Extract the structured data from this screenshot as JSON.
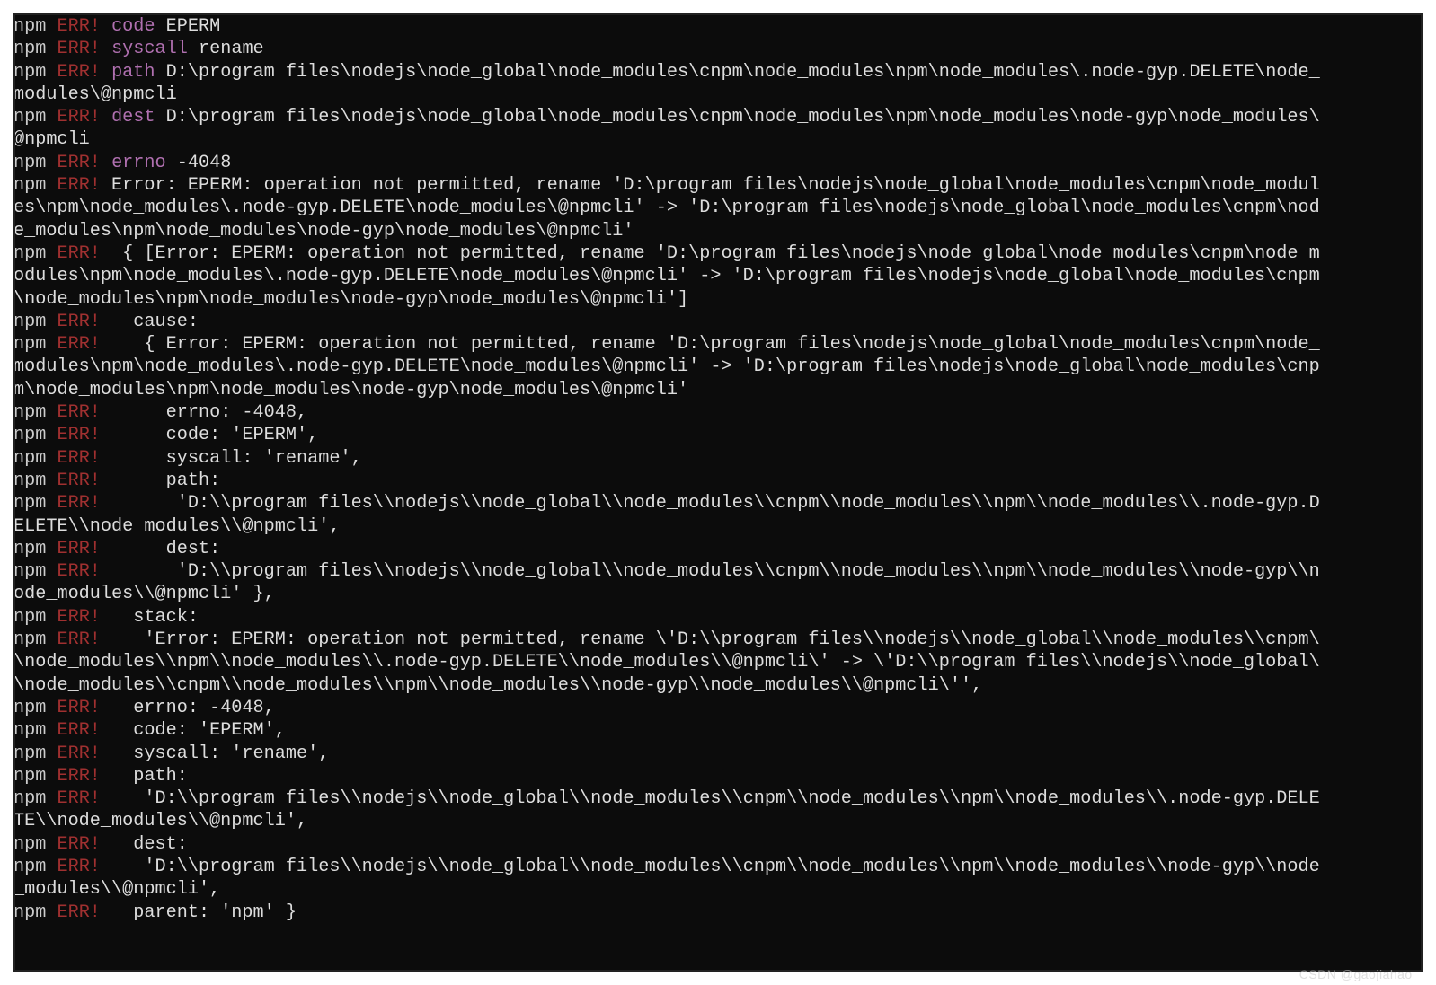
{
  "watermark": "CSDN @gaojiahao_",
  "lines": [
    [
      {
        "c": "npm",
        "t": "npm"
      },
      {
        "c": "txt",
        "t": " "
      },
      {
        "c": "err",
        "t": "ERR!"
      },
      {
        "c": "txt",
        "t": " "
      },
      {
        "c": "key",
        "t": "code"
      },
      {
        "c": "txt",
        "t": " EPERM"
      }
    ],
    [
      {
        "c": "npm",
        "t": "npm"
      },
      {
        "c": "txt",
        "t": " "
      },
      {
        "c": "err",
        "t": "ERR!"
      },
      {
        "c": "txt",
        "t": " "
      },
      {
        "c": "key",
        "t": "syscall"
      },
      {
        "c": "txt",
        "t": " rename"
      }
    ],
    [
      {
        "c": "npm",
        "t": "npm"
      },
      {
        "c": "txt",
        "t": " "
      },
      {
        "c": "err",
        "t": "ERR!"
      },
      {
        "c": "txt",
        "t": " "
      },
      {
        "c": "key",
        "t": "path"
      },
      {
        "c": "txt",
        "t": " D:\\program files\\nodejs\\node_global\\node_modules\\cnpm\\node_modules\\npm\\node_modules\\.node-gyp.DELETE\\node_"
      }
    ],
    [
      {
        "c": "txt",
        "t": "modules\\@npmcli"
      }
    ],
    [
      {
        "c": "npm",
        "t": "npm"
      },
      {
        "c": "txt",
        "t": " "
      },
      {
        "c": "err",
        "t": "ERR!"
      },
      {
        "c": "txt",
        "t": " "
      },
      {
        "c": "key",
        "t": "dest"
      },
      {
        "c": "txt",
        "t": " D:\\program files\\nodejs\\node_global\\node_modules\\cnpm\\node_modules\\npm\\node_modules\\node-gyp\\node_modules\\"
      }
    ],
    [
      {
        "c": "txt",
        "t": "@npmcli"
      }
    ],
    [
      {
        "c": "npm",
        "t": "npm"
      },
      {
        "c": "txt",
        "t": " "
      },
      {
        "c": "err",
        "t": "ERR!"
      },
      {
        "c": "txt",
        "t": " "
      },
      {
        "c": "key",
        "t": "errno"
      },
      {
        "c": "txt",
        "t": " -4048"
      }
    ],
    [
      {
        "c": "npm",
        "t": "npm"
      },
      {
        "c": "txt",
        "t": " "
      },
      {
        "c": "err",
        "t": "ERR!"
      },
      {
        "c": "txt",
        "t": " Error: EPERM: operation not permitted, rename 'D:\\program files\\nodejs\\node_global\\node_modules\\cnpm\\node_modul"
      }
    ],
    [
      {
        "c": "txt",
        "t": "es\\npm\\node_modules\\.node-gyp.DELETE\\node_modules\\@npmcli' -> 'D:\\program files\\nodejs\\node_global\\node_modules\\cnpm\\nod"
      }
    ],
    [
      {
        "c": "txt",
        "t": "e_modules\\npm\\node_modules\\node-gyp\\node_modules\\@npmcli'"
      }
    ],
    [
      {
        "c": "npm",
        "t": "npm"
      },
      {
        "c": "txt",
        "t": " "
      },
      {
        "c": "err",
        "t": "ERR!"
      },
      {
        "c": "txt",
        "t": "  { [Error: EPERM: operation not permitted, rename 'D:\\program files\\nodejs\\node_global\\node_modules\\cnpm\\node_m"
      }
    ],
    [
      {
        "c": "txt",
        "t": "odules\\npm\\node_modules\\.node-gyp.DELETE\\node_modules\\@npmcli' -> 'D:\\program files\\nodejs\\node_global\\node_modules\\cnpm"
      }
    ],
    [
      {
        "c": "txt",
        "t": "\\node_modules\\npm\\node_modules\\node-gyp\\node_modules\\@npmcli']"
      }
    ],
    [
      {
        "c": "npm",
        "t": "npm"
      },
      {
        "c": "txt",
        "t": " "
      },
      {
        "c": "err",
        "t": "ERR!"
      },
      {
        "c": "txt",
        "t": "   cause:"
      }
    ],
    [
      {
        "c": "npm",
        "t": "npm"
      },
      {
        "c": "txt",
        "t": " "
      },
      {
        "c": "err",
        "t": "ERR!"
      },
      {
        "c": "txt",
        "t": "    { Error: EPERM: operation not permitted, rename 'D:\\program files\\nodejs\\node_global\\node_modules\\cnpm\\node_"
      }
    ],
    [
      {
        "c": "txt",
        "t": "modules\\npm\\node_modules\\.node-gyp.DELETE\\node_modules\\@npmcli' -> 'D:\\program files\\nodejs\\node_global\\node_modules\\cnp"
      }
    ],
    [
      {
        "c": "txt",
        "t": "m\\node_modules\\npm\\node_modules\\node-gyp\\node_modules\\@npmcli'"
      }
    ],
    [
      {
        "c": "npm",
        "t": "npm"
      },
      {
        "c": "txt",
        "t": " "
      },
      {
        "c": "err",
        "t": "ERR!"
      },
      {
        "c": "txt",
        "t": "      errno: -4048,"
      }
    ],
    [
      {
        "c": "npm",
        "t": "npm"
      },
      {
        "c": "txt",
        "t": " "
      },
      {
        "c": "err",
        "t": "ERR!"
      },
      {
        "c": "txt",
        "t": "      code: 'EPERM',"
      }
    ],
    [
      {
        "c": "npm",
        "t": "npm"
      },
      {
        "c": "txt",
        "t": " "
      },
      {
        "c": "err",
        "t": "ERR!"
      },
      {
        "c": "txt",
        "t": "      syscall: 'rename',"
      }
    ],
    [
      {
        "c": "npm",
        "t": "npm"
      },
      {
        "c": "txt",
        "t": " "
      },
      {
        "c": "err",
        "t": "ERR!"
      },
      {
        "c": "txt",
        "t": "      path:"
      }
    ],
    [
      {
        "c": "npm",
        "t": "npm"
      },
      {
        "c": "txt",
        "t": " "
      },
      {
        "c": "err",
        "t": "ERR!"
      },
      {
        "c": "txt",
        "t": "       'D:\\\\program files\\\\nodejs\\\\node_global\\\\node_modules\\\\cnpm\\\\node_modules\\\\npm\\\\node_modules\\\\.node-gyp.D"
      }
    ],
    [
      {
        "c": "txt",
        "t": "ELETE\\\\node_modules\\\\@npmcli',"
      }
    ],
    [
      {
        "c": "npm",
        "t": "npm"
      },
      {
        "c": "txt",
        "t": " "
      },
      {
        "c": "err",
        "t": "ERR!"
      },
      {
        "c": "txt",
        "t": "      dest:"
      }
    ],
    [
      {
        "c": "npm",
        "t": "npm"
      },
      {
        "c": "txt",
        "t": " "
      },
      {
        "c": "err",
        "t": "ERR!"
      },
      {
        "c": "txt",
        "t": "       'D:\\\\program files\\\\nodejs\\\\node_global\\\\node_modules\\\\cnpm\\\\node_modules\\\\npm\\\\node_modules\\\\node-gyp\\\\n"
      }
    ],
    [
      {
        "c": "txt",
        "t": "ode_modules\\\\@npmcli' },"
      }
    ],
    [
      {
        "c": "npm",
        "t": "npm"
      },
      {
        "c": "txt",
        "t": " "
      },
      {
        "c": "err",
        "t": "ERR!"
      },
      {
        "c": "txt",
        "t": "   stack:"
      }
    ],
    [
      {
        "c": "npm",
        "t": "npm"
      },
      {
        "c": "txt",
        "t": " "
      },
      {
        "c": "err",
        "t": "ERR!"
      },
      {
        "c": "txt",
        "t": "    'Error: EPERM: operation not permitted, rename \\'D:\\\\program files\\\\nodejs\\\\node_global\\\\node_modules\\\\cnpm\\"
      }
    ],
    [
      {
        "c": "txt",
        "t": "\\node_modules\\\\npm\\\\node_modules\\\\.node-gyp.DELETE\\\\node_modules\\\\@npmcli\\' -> \\'D:\\\\program files\\\\nodejs\\\\node_global\\"
      }
    ],
    [
      {
        "c": "txt",
        "t": "\\node_modules\\\\cnpm\\\\node_modules\\\\npm\\\\node_modules\\\\node-gyp\\\\node_modules\\\\@npmcli\\'',"
      }
    ],
    [
      {
        "c": "npm",
        "t": "npm"
      },
      {
        "c": "txt",
        "t": " "
      },
      {
        "c": "err",
        "t": "ERR!"
      },
      {
        "c": "txt",
        "t": "   errno: -4048,"
      }
    ],
    [
      {
        "c": "npm",
        "t": "npm"
      },
      {
        "c": "txt",
        "t": " "
      },
      {
        "c": "err",
        "t": "ERR!"
      },
      {
        "c": "txt",
        "t": "   code: 'EPERM',"
      }
    ],
    [
      {
        "c": "npm",
        "t": "npm"
      },
      {
        "c": "txt",
        "t": " "
      },
      {
        "c": "err",
        "t": "ERR!"
      },
      {
        "c": "txt",
        "t": "   syscall: 'rename',"
      }
    ],
    [
      {
        "c": "npm",
        "t": "npm"
      },
      {
        "c": "txt",
        "t": " "
      },
      {
        "c": "err",
        "t": "ERR!"
      },
      {
        "c": "txt",
        "t": "   path:"
      }
    ],
    [
      {
        "c": "npm",
        "t": "npm"
      },
      {
        "c": "txt",
        "t": " "
      },
      {
        "c": "err",
        "t": "ERR!"
      },
      {
        "c": "txt",
        "t": "    'D:\\\\program files\\\\nodejs\\\\node_global\\\\node_modules\\\\cnpm\\\\node_modules\\\\npm\\\\node_modules\\\\.node-gyp.DELE"
      }
    ],
    [
      {
        "c": "txt",
        "t": "TE\\\\node_modules\\\\@npmcli',"
      }
    ],
    [
      {
        "c": "npm",
        "t": "npm"
      },
      {
        "c": "txt",
        "t": " "
      },
      {
        "c": "err",
        "t": "ERR!"
      },
      {
        "c": "txt",
        "t": "   dest:"
      }
    ],
    [
      {
        "c": "npm",
        "t": "npm"
      },
      {
        "c": "txt",
        "t": " "
      },
      {
        "c": "err",
        "t": "ERR!"
      },
      {
        "c": "txt",
        "t": "    'D:\\\\program files\\\\nodejs\\\\node_global\\\\node_modules\\\\cnpm\\\\node_modules\\\\npm\\\\node_modules\\\\node-gyp\\\\node"
      }
    ],
    [
      {
        "c": "txt",
        "t": "_modules\\\\@npmcli',"
      }
    ],
    [
      {
        "c": "npm",
        "t": "npm"
      },
      {
        "c": "txt",
        "t": " "
      },
      {
        "c": "err",
        "t": "ERR!"
      },
      {
        "c": "txt",
        "t": "   parent: 'npm' }"
      }
    ]
  ]
}
